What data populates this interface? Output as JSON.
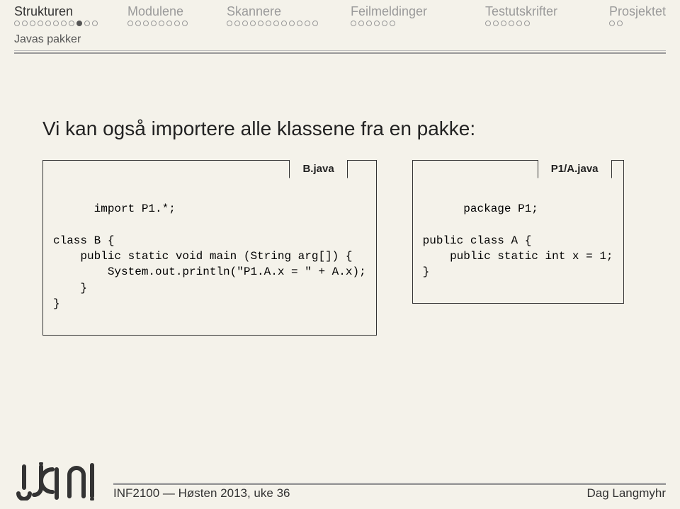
{
  "nav": [
    {
      "label": "Strukturen",
      "dots": 11,
      "active_index": 8,
      "active": true
    },
    {
      "label": "Modulene",
      "dots": 8,
      "active_index": -1,
      "active": false
    },
    {
      "label": "Skannere",
      "dots": 12,
      "active_index": -1,
      "active": false
    },
    {
      "label": "Feilmeldinger",
      "dots": 6,
      "active_index": -1,
      "active": false
    },
    {
      "label": "Testutskrifter",
      "dots": 6,
      "active_index": -1,
      "active": false
    },
    {
      "label": "Prosjektet",
      "dots": 2,
      "active_index": -1,
      "active": false
    }
  ],
  "subsection": "Javas pakker",
  "heading": "Vi kan også importere alle klassene fra en pakke:",
  "code_left": {
    "filename": "B.java",
    "text": "import P1.*;\n\nclass B {\n    public static void main (String arg[]) {\n        System.out.println(\"P1.A.x = \" + A.x);\n    }\n}"
  },
  "code_right": {
    "filename": "P1/A.java",
    "text": "package P1;\n\npublic class A {\n    public static int x = 1;\n}"
  },
  "footer": {
    "left": "INF2100 — Høsten 2013, uke 36",
    "right": "Dag Langmyhr"
  }
}
